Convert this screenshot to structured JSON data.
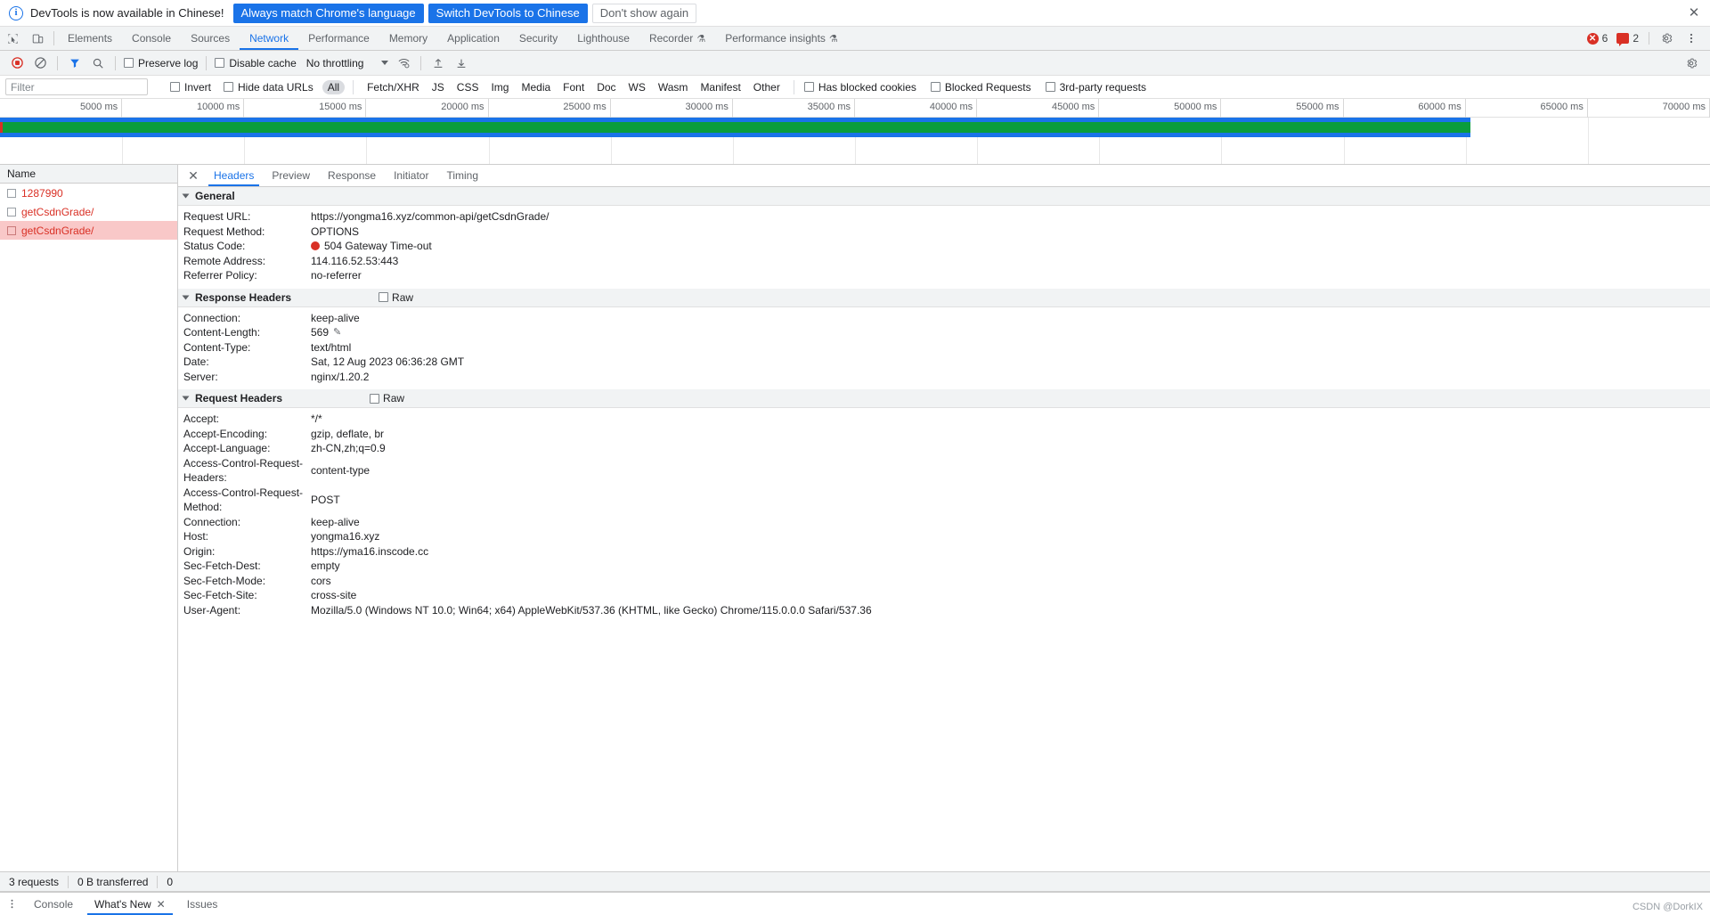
{
  "banner": {
    "info_icon": "info-icon",
    "message": "DevTools is now available in Chinese!",
    "btn_always": "Always match Chrome's language",
    "btn_switch": "Switch DevTools to Chinese",
    "btn_dismiss": "Don't show again",
    "close_icon": "✕",
    "primary_color": "#1a73e8"
  },
  "tabbar": {
    "inspect_icon": "inspect-element-icon",
    "device_icon": "device-toolbar-icon",
    "tabs": [
      {
        "label": "Elements",
        "active": false
      },
      {
        "label": "Console",
        "active": false
      },
      {
        "label": "Sources",
        "active": false
      },
      {
        "label": "Network",
        "active": true
      },
      {
        "label": "Performance",
        "active": false
      },
      {
        "label": "Memory",
        "active": false
      },
      {
        "label": "Application",
        "active": false
      },
      {
        "label": "Security",
        "active": false
      },
      {
        "label": "Lighthouse",
        "active": false
      },
      {
        "label": "Recorder",
        "active": false,
        "beaker": "⚗"
      },
      {
        "label": "Performance insights",
        "active": false,
        "beaker": "⚗"
      }
    ],
    "error_count": "6",
    "warning_count": "2",
    "settings_icon": "gear-icon",
    "more_icon": "kebab-menu-icon"
  },
  "toolbar": {
    "record_icon": "record-stop-icon",
    "clear_icon": "clear-icon",
    "filter_icon": "filter-funnel-icon",
    "search_icon": "search-icon",
    "preserve_log": "Preserve log",
    "disable_cache": "Disable cache",
    "throttling": "No throttling",
    "wifi_icon": "network-conditions-icon",
    "import_icon": "import-har-icon",
    "export_icon": "export-har-icon",
    "settings_icon": "network-settings-gear-icon"
  },
  "filterbar": {
    "placeholder": "Filter",
    "value": "",
    "invert": "Invert",
    "hide_data_urls": "Hide data URLs",
    "types": [
      "All",
      "Fetch/XHR",
      "JS",
      "CSS",
      "Img",
      "Media",
      "Font",
      "Doc",
      "WS",
      "Wasm",
      "Manifest",
      "Other"
    ],
    "active_type": "All",
    "has_blocked_cookies": "Has blocked cookies",
    "blocked_requests": "Blocked Requests",
    "third_party_requests": "3rd-party requests"
  },
  "overview": {
    "ticks": [
      "5000 ms",
      "10000 ms",
      "15000 ms",
      "20000 ms",
      "25000 ms",
      "30000 ms",
      "35000 ms",
      "40000 ms",
      "45000 ms",
      "50000 ms",
      "55000 ms",
      "60000 ms",
      "65000 ms",
      "70000 ms"
    ],
    "bar_end_percent": 86,
    "blue_color": "#1a73e8",
    "green_color": "#0a9d3c",
    "red_color": "#d93025"
  },
  "requests": {
    "column_name": "Name",
    "rows": [
      {
        "name": "1287990",
        "error": true,
        "selected": false
      },
      {
        "name": "getCsdnGrade/",
        "error": true,
        "selected": false
      },
      {
        "name": "getCsdnGrade/",
        "error": true,
        "selected": true
      }
    ]
  },
  "detail": {
    "close_icon": "✕",
    "tabs": [
      {
        "label": "Headers",
        "active": true
      },
      {
        "label": "Preview",
        "active": false
      },
      {
        "label": "Response",
        "active": false
      },
      {
        "label": "Initiator",
        "active": false
      },
      {
        "label": "Timing",
        "active": false
      }
    ],
    "general": {
      "title": "General",
      "rows": [
        {
          "key": "Request URL:",
          "value": "https://yongma16.xyz/common-api/getCsdnGrade/"
        },
        {
          "key": "Request Method:",
          "value": "OPTIONS"
        },
        {
          "key": "Status Code:",
          "value": "504 Gateway Time-out",
          "status": true
        },
        {
          "key": "Remote Address:",
          "value": "114.116.52.53:443"
        },
        {
          "key": "Referrer Policy:",
          "value": "no-referrer"
        }
      ]
    },
    "response_headers": {
      "title": "Response Headers",
      "raw_label": "Raw",
      "rows": [
        {
          "key": "Connection:",
          "value": "keep-alive"
        },
        {
          "key": "Content-Length:",
          "value": "569",
          "pencil": true
        },
        {
          "key": "Content-Type:",
          "value": "text/html"
        },
        {
          "key": "Date:",
          "value": "Sat, 12 Aug 2023 06:36:28 GMT"
        },
        {
          "key": "Server:",
          "value": "nginx/1.20.2"
        }
      ]
    },
    "request_headers": {
      "title": "Request Headers",
      "raw_label": "Raw",
      "rows": [
        {
          "key": "Accept:",
          "value": "*/*"
        },
        {
          "key": "Accept-Encoding:",
          "value": "gzip, deflate, br"
        },
        {
          "key": "Accept-Language:",
          "value": "zh-CN,zh;q=0.9"
        },
        {
          "key": "Access-Control-Request-Headers:",
          "value": "content-type"
        },
        {
          "key": "Access-Control-Request-Method:",
          "value": "POST"
        },
        {
          "key": "Connection:",
          "value": "keep-alive"
        },
        {
          "key": "Host:",
          "value": "yongma16.xyz"
        },
        {
          "key": "Origin:",
          "value": "https://yma16.inscode.cc"
        },
        {
          "key": "Sec-Fetch-Dest:",
          "value": "empty"
        },
        {
          "key": "Sec-Fetch-Mode:",
          "value": "cors"
        },
        {
          "key": "Sec-Fetch-Site:",
          "value": "cross-site"
        },
        {
          "key": "User-Agent:",
          "value": "Mozilla/5.0 (Windows NT 10.0; Win64; x64) AppleWebKit/537.36 (KHTML, like Gecko) Chrome/115.0.0.0 Safari/537.36"
        }
      ]
    }
  },
  "statusbar": {
    "requests": "3 requests",
    "transferred": "0 B transferred",
    "resources": "0"
  },
  "drawer": {
    "kebab_icon": "kebab-menu-icon",
    "tabs": [
      {
        "label": "Console",
        "active": false,
        "closeable": false
      },
      {
        "label": "What's New",
        "active": true,
        "closeable": true
      },
      {
        "label": "Issues",
        "active": false,
        "closeable": false
      }
    ]
  },
  "watermark": "CSDN @DorkIX"
}
